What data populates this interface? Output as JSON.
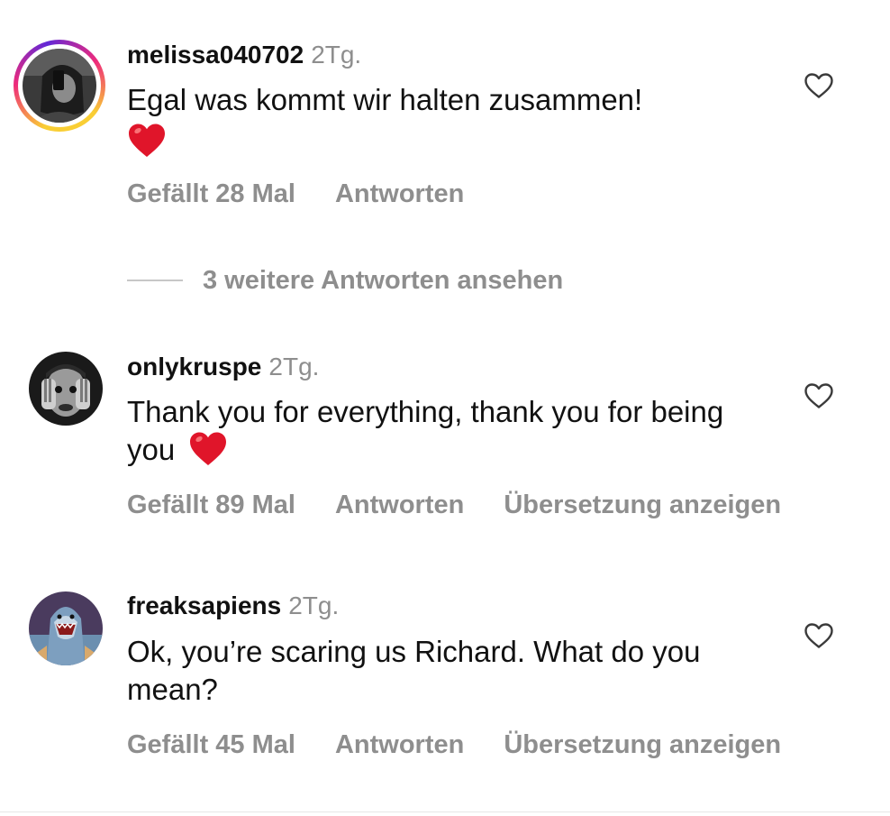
{
  "comments": [
    {
      "username": "melissa040702",
      "time": "2Tg.",
      "text": "Egal was kommt wir halten zusammen!",
      "has_heart_emoji": true,
      "likes_label": "Gefällt 28 Mal",
      "reply_label": "Antworten",
      "avatar_icon": "selfie-avatar",
      "has_story_ring": true
    },
    {
      "username": "onlykruspe",
      "time": "2Tg.",
      "text": "Thank you for everything, thank you for being you",
      "has_heart_emoji": true,
      "likes_label": "Gefällt 89 Mal",
      "reply_label": "Antworten",
      "translate_label": "Übersetzung anzeigen",
      "avatar_icon": "bw-face-avatar",
      "has_story_ring": false
    },
    {
      "username": "freaksapiens",
      "time": "2Tg.",
      "text": "Ok, you’re scaring us Richard. What do you mean?",
      "has_heart_emoji": false,
      "likes_label": "Gefällt 45 Mal",
      "reply_label": "Antworten",
      "translate_label": "Übersetzung anzeigen",
      "avatar_icon": "shark-avatar",
      "has_story_ring": false
    }
  ],
  "view_replies_label": "3 weitere Antworten ansehen",
  "colors": {
    "text": "#111111",
    "muted": "#8e8e8e",
    "heart_emoji": "#e0152a",
    "divider": "#c7c7c7"
  },
  "icons": {
    "like": "heart-outline-icon",
    "emoji": "red-heart-emoji"
  }
}
